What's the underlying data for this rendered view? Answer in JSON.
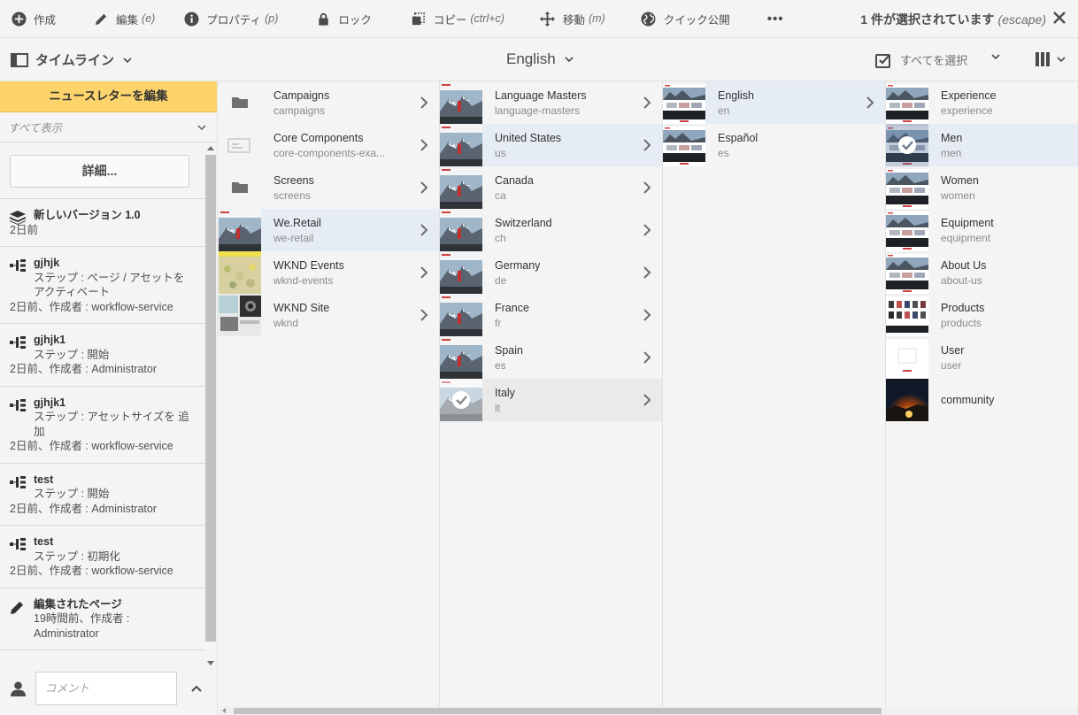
{
  "actionbar": {
    "create": {
      "label": "作成",
      "shortcut": ""
    },
    "edit": {
      "label": "編集",
      "shortcut": "(e)"
    },
    "properties": {
      "label": "プロパティ",
      "shortcut": "(p)"
    },
    "lock": {
      "label": "ロック",
      "shortcut": ""
    },
    "copy": {
      "label": "コピー",
      "shortcut": "(ctrl+c)"
    },
    "move": {
      "label": "移動",
      "shortcut": "(m)"
    },
    "quick_publish": {
      "label": "クイック公開",
      "shortcut": ""
    },
    "more": "•••",
    "selection": "1 件が選択されています",
    "escape": "(escape)"
  },
  "titlebar": {
    "rail_label": "タイムライン",
    "title": "English",
    "select_all": "すべてを選択"
  },
  "rail": {
    "banner": "ニュースレターを編集",
    "filter": "すべて表示",
    "detail_button": "詳細...",
    "items": [
      {
        "icon": "layers-icon",
        "title": "新しいバージョン 1.0",
        "step": "",
        "meta": "2日前"
      },
      {
        "icon": "workflow-icon",
        "title": "gjhjk",
        "step": "ステップ : ページ / アセットを アクティベート",
        "meta": "2日前、作成者 : workflow-service"
      },
      {
        "icon": "workflow-icon",
        "title": "gjhjk1",
        "step": "ステップ : 開始",
        "meta": "2日前、作成者 : Administrator"
      },
      {
        "icon": "workflow-icon",
        "title": "gjhjk1",
        "step": "ステップ : アセットサイズを 追加",
        "meta": "2日前、作成者 : workflow-service"
      },
      {
        "icon": "workflow-icon",
        "title": "test",
        "step": "ステップ : 開始",
        "meta": "2日前、作成者 : Administrator"
      },
      {
        "icon": "workflow-icon",
        "title": "test",
        "step": "ステップ : 初期化",
        "meta": "2日前、作成者 : workflow-service"
      },
      {
        "icon": "pencil-icon",
        "title": "編集されたページ",
        "step": "19時間前、作成者 : Administrator",
        "meta": ""
      }
    ],
    "comment_placeholder": "コメント"
  },
  "columns": [
    {
      "items": [
        {
          "name": "Campaigns",
          "sub": "campaigns",
          "thumb": "folder",
          "arrow": true
        },
        {
          "name": "Core Components",
          "sub": "core-components-exa...",
          "thumb": "component",
          "arrow": true
        },
        {
          "name": "Screens",
          "sub": "screens",
          "thumb": "folder",
          "arrow": true
        },
        {
          "name": "We.Retail",
          "sub": "we-retail",
          "thumb": "mountain",
          "arrow": true,
          "selected": true
        },
        {
          "name": "WKND Events",
          "sub": "wknd-events",
          "thumb": "flowers",
          "arrow": true
        },
        {
          "name": "WKND Site",
          "sub": "wknd",
          "thumb": "camera",
          "arrow": true
        }
      ]
    },
    {
      "items": [
        {
          "name": "Language Masters",
          "sub": "language-masters",
          "thumb": "mountain",
          "arrow": true
        },
        {
          "name": "United States",
          "sub": "us",
          "thumb": "mountain",
          "arrow": true,
          "selected": true
        },
        {
          "name": "Canada",
          "sub": "ca",
          "thumb": "mountain",
          "arrow": true
        },
        {
          "name": "Switzerland",
          "sub": "ch",
          "thumb": "mountain",
          "arrow": true
        },
        {
          "name": "Germany",
          "sub": "de",
          "thumb": "mountain",
          "arrow": true
        },
        {
          "name": "France",
          "sub": "fr",
          "thumb": "mountain",
          "arrow": true
        },
        {
          "name": "Spain",
          "sub": "es",
          "thumb": "mountain",
          "arrow": true
        },
        {
          "name": "Italy",
          "sub": "it",
          "thumb": "mountain-check",
          "arrow": true,
          "hover": true
        }
      ]
    },
    {
      "items": [
        {
          "name": "English",
          "sub": "en",
          "thumb": "page",
          "arrow": true,
          "selected": true
        },
        {
          "name": "Español",
          "sub": "es",
          "thumb": "page",
          "arrow": false
        }
      ]
    },
    {
      "items": [
        {
          "name": "Experience",
          "sub": "experience",
          "thumb": "page",
          "arrow": false
        },
        {
          "name": "Men",
          "sub": "men",
          "thumb": "page-check",
          "arrow": false,
          "selected": true
        },
        {
          "name": "Women",
          "sub": "women",
          "thumb": "page",
          "arrow": false
        },
        {
          "name": "Equipment",
          "sub": "equipment",
          "thumb": "page",
          "arrow": false
        },
        {
          "name": "About Us",
          "sub": "about-us",
          "thumb": "page",
          "arrow": false
        },
        {
          "name": "Products",
          "sub": "products",
          "thumb": "products",
          "arrow": false
        },
        {
          "name": "User",
          "sub": "user",
          "thumb": "blank",
          "arrow": false
        },
        {
          "name": "community",
          "sub": "",
          "thumb": "night",
          "arrow": false
        }
      ]
    }
  ],
  "colors": {
    "accent_banner": "#fdd46b",
    "selected_row": "#e6ecf3",
    "background": "#f4f4f4"
  }
}
